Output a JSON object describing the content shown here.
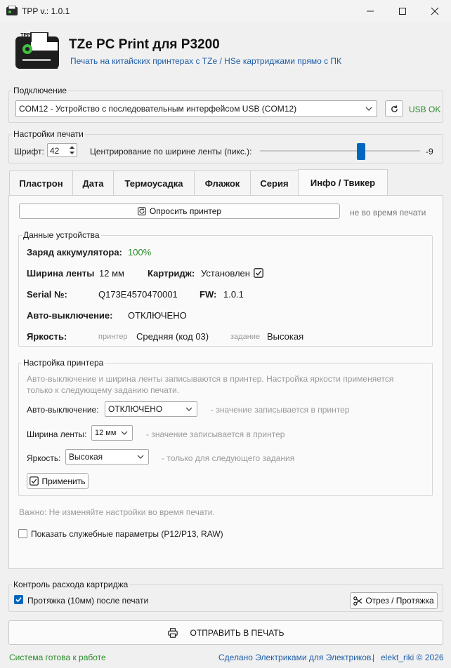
{
  "window": {
    "title": "TPP v.: 1.0.1"
  },
  "header": {
    "title": "TZe PC Print для P3200",
    "subtitle": "Печать на китайских принтерах с TZe / HSe картриджами прямо с ПК",
    "logo_text": "TPP"
  },
  "connection": {
    "legend": "Подключение",
    "port": "COM12 - Устройство с последовательным интерфейсом USB (COM12)",
    "status": "USB OK"
  },
  "print_settings": {
    "legend": "Настройки печати",
    "font_label": "Шрифт:",
    "font_value": "42",
    "center_label": "Центрирование по ширине ленты (пикс.):",
    "center_value": "-9",
    "slider_fraction": 0.64
  },
  "tabs": [
    {
      "label": "Пластрон"
    },
    {
      "label": "Дата"
    },
    {
      "label": "Термоусадка"
    },
    {
      "label": "Флажок"
    },
    {
      "label": "Серия"
    },
    {
      "label": "Инфо / Твикер"
    }
  ],
  "info": {
    "query_button": "Опросить принтер",
    "query_note": "не во время печати",
    "device": {
      "legend": "Данные устройства",
      "battery_label": "Заряд аккумулятора:",
      "battery_value": "100%",
      "tape_label": "Ширина ленты",
      "tape_value": "12 мм",
      "cartridge_label": "Картридж:",
      "cartridge_value": "Установлен",
      "serial_label": "Serial №:",
      "serial_value": "Q173E4570470001",
      "fw_label": "FW:",
      "fw_value": "1.0.1",
      "autooff_label": "Авто-выключение:",
      "autooff_value": "ОТКЛЮЧЕНО",
      "brightness_label": "Яркость:",
      "printer_label": "принтер",
      "printer_value": "Средняя (код 03)",
      "job_label": "задание",
      "job_value": "Высокая"
    },
    "setup": {
      "legend": "Настройка принтера",
      "description": "Авто-выключение и ширина ленты записываются в принтер. Настройка яркости применяется только к следующему заданию печати.",
      "autooff_label": "Авто-выключение:",
      "autooff_value": "ОТКЛЮЧЕНО",
      "autooff_note": "- значение записывается в принтер",
      "tape_label": "Ширина ленты:",
      "tape_value": "12 мм",
      "tape_note": "- значение записывается в принтер",
      "brightness_label": "Яркость:",
      "brightness_value": "Высокая",
      "brightness_note": "- только для следующего задания",
      "apply_button": "Применить"
    },
    "warning": "Важно: Не изменяйте настройки во время печати.",
    "service_checkbox": "Показать служебные параметры (P12/P13, RAW)"
  },
  "cartridge": {
    "legend": "Контроль расхода картриджа",
    "feed_checkbox": "Протяжка (10мм) после печати",
    "cut_button": "Отрез / Протяжка"
  },
  "print_button": "ОТПРАВИТЬ В ПЕЧАТЬ",
  "statusbar": {
    "status": "Система готова к работе",
    "credit": "Сделано Электриками для Электриков.",
    "separator": "|",
    "author": "elekt_riki © 2026"
  },
  "colors": {
    "accent": "#0067c0",
    "status_green": "#2b8a2b",
    "link_blue": "#1f5ea8"
  }
}
